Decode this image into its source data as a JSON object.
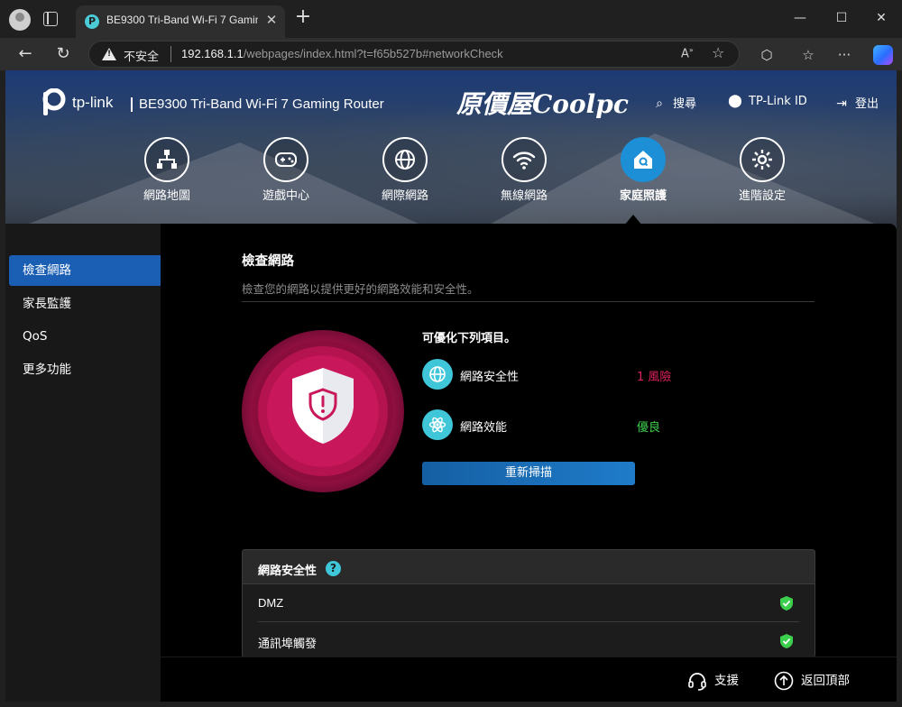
{
  "browser": {
    "tab_title": "BE9300 Tri-Band Wi-Fi 7 Gaming Router",
    "tab_favicon": "P",
    "insecure_label": "不安全",
    "url_host": "192.168.1.1",
    "url_path": "/webpages/index.html?t=f65b527b#networkCheck"
  },
  "header": {
    "brand": "tp-link",
    "model": "BE9300 Tri-Band Wi-Fi 7 Gaming Router",
    "watermark": "原價屋Coolpc",
    "search": "搜尋",
    "account": "TP-Link ID",
    "logout": "登出"
  },
  "nav": {
    "items": [
      {
        "label": "網路地圖",
        "icon": "network-map-icon"
      },
      {
        "label": "遊戲中心",
        "icon": "gamepad-icon"
      },
      {
        "label": "網際網路",
        "icon": "globe-icon"
      },
      {
        "label": "無線網路",
        "icon": "wifi-icon"
      },
      {
        "label": "家庭照護",
        "icon": "home-care-icon"
      },
      {
        "label": "進階設定",
        "icon": "gear-icon"
      }
    ],
    "active": "家庭照護"
  },
  "sidebar": {
    "items": [
      {
        "label": "檢查網路"
      },
      {
        "label": "家長監護"
      },
      {
        "label": "QoS"
      },
      {
        "label": "更多功能"
      }
    ],
    "active": "檢查網路"
  },
  "main": {
    "title": "檢查網路",
    "description": "檢查您的網路以提供更好的網路效能和安全性。",
    "optimize_title": "可優化下列項目。",
    "items": [
      {
        "label": "網路安全性",
        "value": "1 風險",
        "value_color": "#e0245e",
        "icon": "globe-icon"
      },
      {
        "label": "網路效能",
        "value": "優良",
        "value_color": "#3ccf4e",
        "icon": "atom-icon"
      }
    ],
    "rescan": "重新掃描"
  },
  "security_card": {
    "title": "網路安全性",
    "help": "?",
    "rows": [
      {
        "label": "DMZ"
      },
      {
        "label": "通訊埠觸發"
      }
    ]
  },
  "footer": {
    "support": "支援",
    "back_to_top": "返回頂部"
  },
  "colors": {
    "accent": "#1a5fb4",
    "teal": "#3fc6d9",
    "risk": "#e0245e",
    "ok": "#3ccf4e"
  }
}
